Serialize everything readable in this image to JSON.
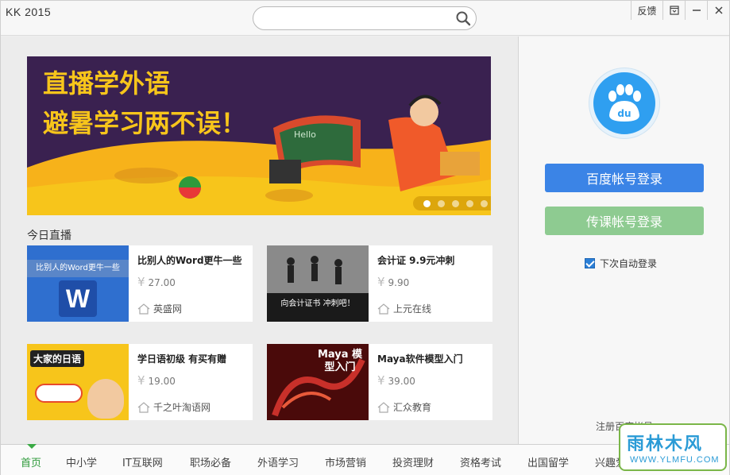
{
  "app": {
    "title": "KK 2015"
  },
  "search": {
    "placeholder": "",
    "value": ""
  },
  "window_buttons": {
    "feedback": "反馈"
  },
  "banner": {
    "headline_line1": "直播学外语",
    "headline_line2": "避暑学习两不误！",
    "board_text": "Hello",
    "active_slide": 1,
    "slide_count": 5
  },
  "section": {
    "title": "今日直播"
  },
  "courses": [
    {
      "name": "比别人的Word更牛一些",
      "price": "27.00",
      "org": "英盛网",
      "thumb_text": "比别人的Word更牛一些"
    },
    {
      "name": "会计证 9.9元冲刺",
      "price": "9.90",
      "org": "上元在线",
      "thumb_text": "向会计证书 冲刺吧！"
    },
    {
      "name": "学日语初级 有买有赠",
      "price": "19.00",
      "org": "千之叶淘语网",
      "thumb_text": "大家的日语"
    },
    {
      "name": "Maya软件模型入门",
      "price": "39.00",
      "org": "汇众教育",
      "thumb_text": "Maya 模型入门"
    }
  ],
  "currency_symbol": "¥",
  "sidebar": {
    "logo_text": "du",
    "baidu_login": "百度帐号登录",
    "chuanke_login": "传课帐号登录",
    "auto_login": "下次自动登录",
    "auto_login_checked": true,
    "register": "注册百度帐号"
  },
  "nav": {
    "items": [
      "首页",
      "中小学",
      "IT互联网",
      "职场必备",
      "外语学习",
      "市场营销",
      "投资理财",
      "资格考试",
      "出国留学",
      "兴趣爱好"
    ],
    "active": "首页"
  },
  "watermark": {
    "main": "雨林木风",
    "sub": "WWW.YLMFU.COM"
  },
  "colors": {
    "accent_blue": "#3b84e6",
    "accent_green": "#8ecb91",
    "nav_active": "#2e9a3b",
    "banner_bg": "#3a2150",
    "banner_yellow": "#f7c51b"
  }
}
